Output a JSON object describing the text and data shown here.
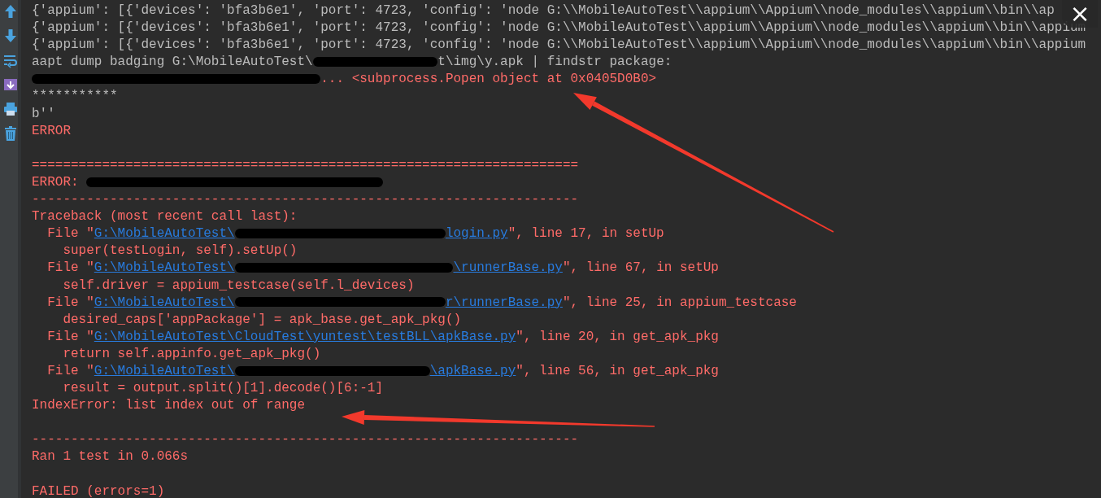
{
  "toolbar": {
    "buttons": [
      {
        "kind": "up"
      },
      {
        "kind": "down"
      },
      {
        "kind": "wrap"
      },
      {
        "kind": "scroll"
      },
      {
        "kind": "print"
      },
      {
        "kind": "trash"
      }
    ]
  },
  "console": {
    "lines": [
      {
        "kind": "stdout",
        "segments": [
          {
            "kind": "text",
            "text": "{'appium': [{'devices': 'bfa3b6e1', 'port': 4723, 'config': 'node G:\\\\MobileAutoTest\\\\appium\\\\Appium\\\\node_modules\\\\appium\\\\bin\\\\ap"
          }
        ]
      },
      {
        "kind": "stdout",
        "segments": [
          {
            "kind": "text",
            "text": "{'appium': [{'devices': 'bfa3b6e1', 'port': 4723, 'config': 'node G:\\\\MobileAutoTest\\\\appium\\\\Appium\\\\node_modules\\\\appium\\\\bin\\\\appium"
          }
        ]
      },
      {
        "kind": "stdout",
        "segments": [
          {
            "kind": "text",
            "text": "{'appium': [{'devices': 'bfa3b6e1', 'port': 4723, 'config': 'node G:\\\\MobileAutoTest\\\\appium\\\\Appium\\\\node_modules\\\\appium\\\\bin\\\\appium"
          }
        ]
      },
      {
        "kind": "stdout",
        "segments": [
          {
            "kind": "text",
            "text": "aapt dump badging G:\\MobileAutoTest\\"
          },
          {
            "kind": "redaction"
          },
          {
            "kind": "text",
            "text": "t\\img\\y.apk | findstr package:"
          }
        ]
      },
      {
        "kind": "stderr",
        "segments": [
          {
            "kind": "redaction"
          },
          {
            "kind": "text",
            "text": "... <subprocess.Popen object at 0x0405D0B0>"
          }
        ]
      },
      {
        "kind": "stdout",
        "segments": [
          {
            "kind": "text",
            "text": "***********"
          }
        ]
      },
      {
        "kind": "stdout",
        "segments": [
          {
            "kind": "text",
            "text": "b''"
          }
        ]
      },
      {
        "kind": "stderr",
        "segments": [
          {
            "kind": "text",
            "text": "ERROR"
          }
        ]
      },
      {
        "kind": "blank"
      },
      {
        "kind": "stderr",
        "segments": [
          {
            "kind": "text",
            "text": "======================================================================"
          }
        ]
      },
      {
        "kind": "stderr",
        "segments": [
          {
            "kind": "text",
            "text": "ERROR: "
          },
          {
            "kind": "redaction"
          }
        ]
      },
      {
        "kind": "stderr",
        "segments": [
          {
            "kind": "text",
            "text": "----------------------------------------------------------------------"
          }
        ]
      },
      {
        "kind": "stderr",
        "segments": [
          {
            "kind": "text",
            "text": "Traceback (most recent call last):"
          }
        ]
      },
      {
        "kind": "stderr",
        "segments": [
          {
            "kind": "text",
            "text": "  File \""
          },
          {
            "kind": "link",
            "text": "G:\\MobileAutoTest\\"
          },
          {
            "kind": "redaction"
          },
          {
            "kind": "link",
            "text": "login.py"
          },
          {
            "kind": "text",
            "text": "\", line 17, in setUp"
          }
        ]
      },
      {
        "kind": "stderr",
        "segments": [
          {
            "kind": "text",
            "text": "    super(testLogin, self).setUp()"
          }
        ]
      },
      {
        "kind": "stderr",
        "segments": [
          {
            "kind": "text",
            "text": "  File \""
          },
          {
            "kind": "link",
            "text": "G:\\MobileAutoTest\\"
          },
          {
            "kind": "redaction"
          },
          {
            "kind": "link",
            "text": "\\runnerBase.py"
          },
          {
            "kind": "text",
            "text": "\", line 67, in setUp"
          }
        ]
      },
      {
        "kind": "stderr",
        "segments": [
          {
            "kind": "text",
            "text": "    self.driver = appium_testcase(self.l_devices)"
          }
        ]
      },
      {
        "kind": "stderr",
        "segments": [
          {
            "kind": "text",
            "text": "  File \""
          },
          {
            "kind": "link",
            "text": "G:\\MobileAutoTest\\"
          },
          {
            "kind": "redaction"
          },
          {
            "kind": "link",
            "text": "r\\runnerBase.py"
          },
          {
            "kind": "text",
            "text": "\", line 25, in appium_testcase"
          }
        ]
      },
      {
        "kind": "stderr",
        "segments": [
          {
            "kind": "text",
            "text": "    desired_caps['appPackage'] = apk_base.get_apk_pkg()"
          }
        ]
      },
      {
        "kind": "stderr",
        "segments": [
          {
            "kind": "text",
            "text": "  File \""
          },
          {
            "kind": "link",
            "text": "G:\\MobileAutoTest\\CloudTest\\yuntest\\testBLL\\apkBase.py"
          },
          {
            "kind": "text",
            "text": "\", line 20, in get_apk_pkg"
          }
        ]
      },
      {
        "kind": "stderr",
        "segments": [
          {
            "kind": "text",
            "text": "    return self.appinfo.get_apk_pkg()"
          }
        ]
      },
      {
        "kind": "stderr",
        "segments": [
          {
            "kind": "text",
            "text": "  File \""
          },
          {
            "kind": "link",
            "text": "G:\\MobileAutoTest\\"
          },
          {
            "kind": "redaction"
          },
          {
            "kind": "link",
            "text": "\\apkBase.py"
          },
          {
            "kind": "text",
            "text": "\", line 56, in get_apk_pkg"
          }
        ]
      },
      {
        "kind": "stderr",
        "segments": [
          {
            "kind": "text",
            "text": "    result = output.split()[1].decode()[6:-1]"
          }
        ]
      },
      {
        "kind": "stderr",
        "segments": [
          {
            "kind": "text",
            "text": "IndexError: list index out of range"
          }
        ]
      },
      {
        "kind": "blank"
      },
      {
        "kind": "stderr",
        "segments": [
          {
            "kind": "text",
            "text": "----------------------------------------------------------------------"
          }
        ]
      },
      {
        "kind": "stderr",
        "segments": [
          {
            "kind": "text",
            "text": "Ran 1 test in 0.066s"
          }
        ]
      },
      {
        "kind": "blank"
      },
      {
        "kind": "stderr",
        "segments": [
          {
            "kind": "text",
            "text": "FAILED (errors=1)"
          }
        ]
      }
    ]
  },
  "close_button": {
    "text": "×"
  },
  "annotations": [
    {
      "kind": "arrow"
    },
    {
      "kind": "arrow"
    }
  ]
}
